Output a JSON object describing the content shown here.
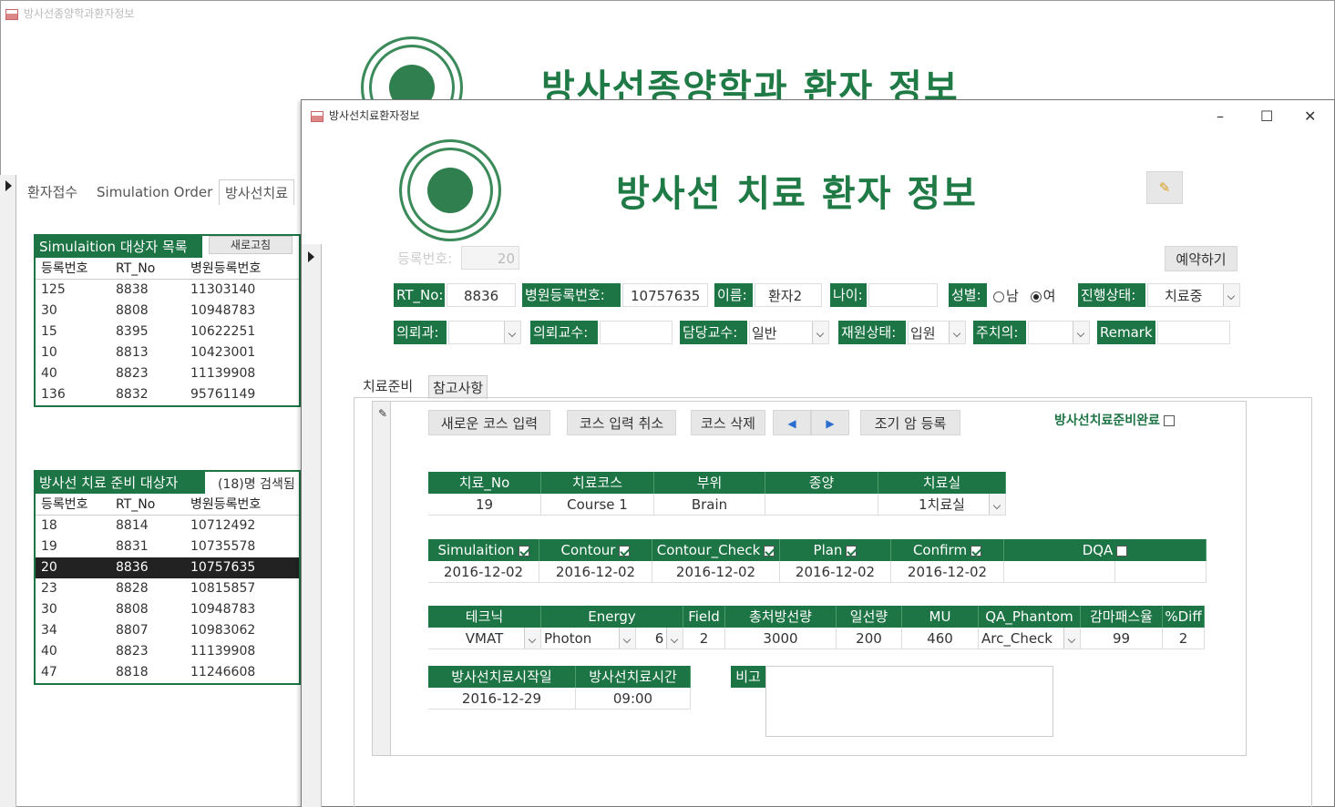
{
  "bg_window": {
    "title": "방사선종양학과환자정보",
    "header_title": "방사선종양학과 환자 정보",
    "tabs": [
      "환자접수",
      "Simulation Order",
      "방사선치료"
    ],
    "sim_list": {
      "title": "Simulaition 대상자 목록",
      "refresh_label": "새로고침",
      "columns": [
        "등록번호",
        "RT_No",
        "병원등록번호"
      ],
      "rows": [
        [
          "125",
          "8838",
          "11303140"
        ],
        [
          "30",
          "8808",
          "10948783"
        ],
        [
          "15",
          "8395",
          "10622251"
        ],
        [
          "10",
          "8813",
          "10423001"
        ],
        [
          "40",
          "8823",
          "11139908"
        ],
        [
          "136",
          "8832",
          "95761149"
        ]
      ]
    },
    "prep_list": {
      "title": "방사선 치료 준비 대상자",
      "count_label": "(18)명 검색됨",
      "columns": [
        "등록번호",
        "RT_No",
        "병원등록번호"
      ],
      "rows": [
        [
          "18",
          "8814",
          "10712492"
        ],
        [
          "19",
          "8831",
          "10735578"
        ],
        [
          "20",
          "8836",
          "10757635"
        ],
        [
          "23",
          "8828",
          "10815857"
        ],
        [
          "30",
          "8808",
          "10948783"
        ],
        [
          "34",
          "8807",
          "10983062"
        ],
        [
          "40",
          "8823",
          "11139908"
        ],
        [
          "47",
          "8818",
          "11246608"
        ]
      ],
      "selected_index": 2
    }
  },
  "main_window": {
    "title": "방사선치료환자정보",
    "header_title": "방사선 치료 환자 정보",
    "controls": {
      "minimize": "–",
      "maximize": "☐",
      "close": "✕"
    },
    "reg_no_label": "등록번호:",
    "reg_no_value": "20",
    "reserve_button": "예약하기",
    "row1": {
      "rt_no_label": "RT_No:",
      "rt_no_value": "8836",
      "hosp_no_label": "병원등록번호:",
      "hosp_no_value": "10757635",
      "name_label": "이름:",
      "name_value": "환자2",
      "age_label": "나이:",
      "age_value": "",
      "sex_label": "성별:",
      "sex_male": "남",
      "sex_female": "여",
      "status_label": "진행상태:",
      "status_value": "치료중"
    },
    "row2": {
      "dept_label": "의뢰과:",
      "dept_value": "",
      "ref_prof_label": "의뢰교수:",
      "ref_prof_value": "",
      "charge_prof_label": "담당교수:",
      "charge_prof_value": "일반",
      "inpatient_label": "재원상태:",
      "inpatient_value": "입원",
      "doctor_label": "주치의:",
      "doctor_value": "",
      "remark_label": "Remark",
      "remark_value": ""
    },
    "tabs": [
      "치료준비",
      "참고사항"
    ],
    "toolbar": {
      "new_course": "새로운 코스 입력",
      "cancel_course": "코스 입력 취소",
      "delete_course": "코스 삭제",
      "prev": "◀",
      "next": "▶",
      "early_cancer": "조기 암 등록",
      "prep_done_label": "방사선치료준비완료"
    },
    "course_table": {
      "headers": [
        "치료_No",
        "치료코스",
        "부위",
        "종양",
        "치료실"
      ],
      "values": [
        "19",
        "Course 1",
        "Brain",
        "",
        "1치료실"
      ]
    },
    "workflow_table": {
      "headers": [
        "Simulaition",
        "Contour",
        "Contour_Check",
        "Plan",
        "Confirm",
        "DQA"
      ],
      "checked": [
        true,
        true,
        true,
        true,
        true,
        false
      ],
      "values": [
        "2016-12-02",
        "2016-12-02",
        "2016-12-02",
        "2016-12-02",
        "2016-12-02",
        ""
      ]
    },
    "tech_table": {
      "headers": [
        "테크닉",
        "Energy",
        "Field",
        "총처방선량",
        "일선량",
        "MU",
        "QA_Phantom",
        "감마패스율",
        "%Diff"
      ],
      "values": [
        "VMAT",
        "Photon",
        "6",
        "2",
        "3000",
        "200",
        "460",
        "Arc_Check",
        "99",
        "2"
      ]
    },
    "start_table": {
      "headers": [
        "방사선치료시작일",
        "방사선치료시간"
      ],
      "values": [
        "2016-12-29",
        "09:00"
      ]
    },
    "note_label": "비고",
    "note_value": ""
  }
}
